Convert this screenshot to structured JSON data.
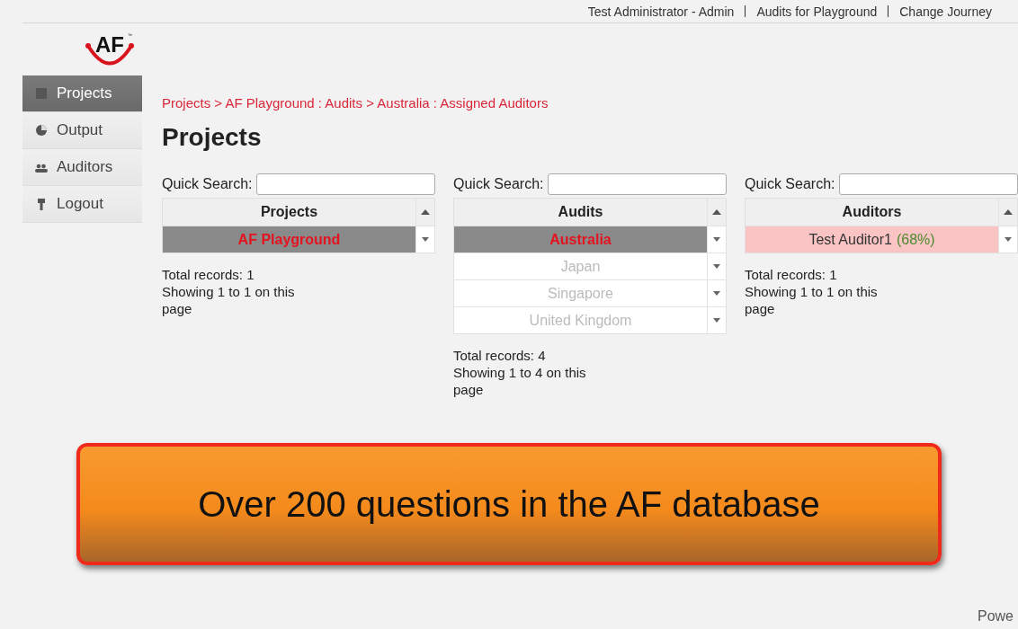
{
  "top_links": [
    "Test Administrator - Admin",
    "Audits for Playground",
    "Change Journey"
  ],
  "logo": {
    "text": "AF",
    "mark": "™"
  },
  "sidebar": {
    "items": [
      {
        "label": "Projects",
        "kind": "square",
        "selected": true
      },
      {
        "label": "Output",
        "kind": "pie",
        "selected": false
      },
      {
        "label": "Auditors",
        "kind": "people",
        "selected": false
      },
      {
        "label": "Logout",
        "kind": "pin",
        "selected": false
      }
    ]
  },
  "breadcrumb": "Projects > AF Playground : Audits > Australia : Assigned Auditors",
  "title": "Projects",
  "panels": [
    {
      "search_label": "Quick Search:",
      "column": "Projects",
      "rows": [
        {
          "label": "AF Playground",
          "kind": "selected"
        }
      ],
      "total": "Total records: 1",
      "showing": "Showing 1 to 1 on this page"
    },
    {
      "search_label": "Quick Search:",
      "column": "Audits",
      "rows": [
        {
          "label": "Australia",
          "kind": "selected"
        },
        {
          "label": "Japan",
          "kind": "plain"
        },
        {
          "label": "Singapore",
          "kind": "plain"
        },
        {
          "label": "United Kingdom",
          "kind": "plain"
        }
      ],
      "total": "Total records: 4",
      "showing": "Showing 1 to 4 on this page"
    },
    {
      "search_label": "Quick Search:",
      "column": "Auditors",
      "rows": [
        {
          "label": "Test Auditor1",
          "score": "(68%)",
          "kind": "assigned"
        }
      ],
      "total": "Total records: 1",
      "showing": "Showing 1 to 1 on this page"
    }
  ],
  "banner": {
    "text": "Over 200 questions in the AF database"
  },
  "footer": "Powe"
}
